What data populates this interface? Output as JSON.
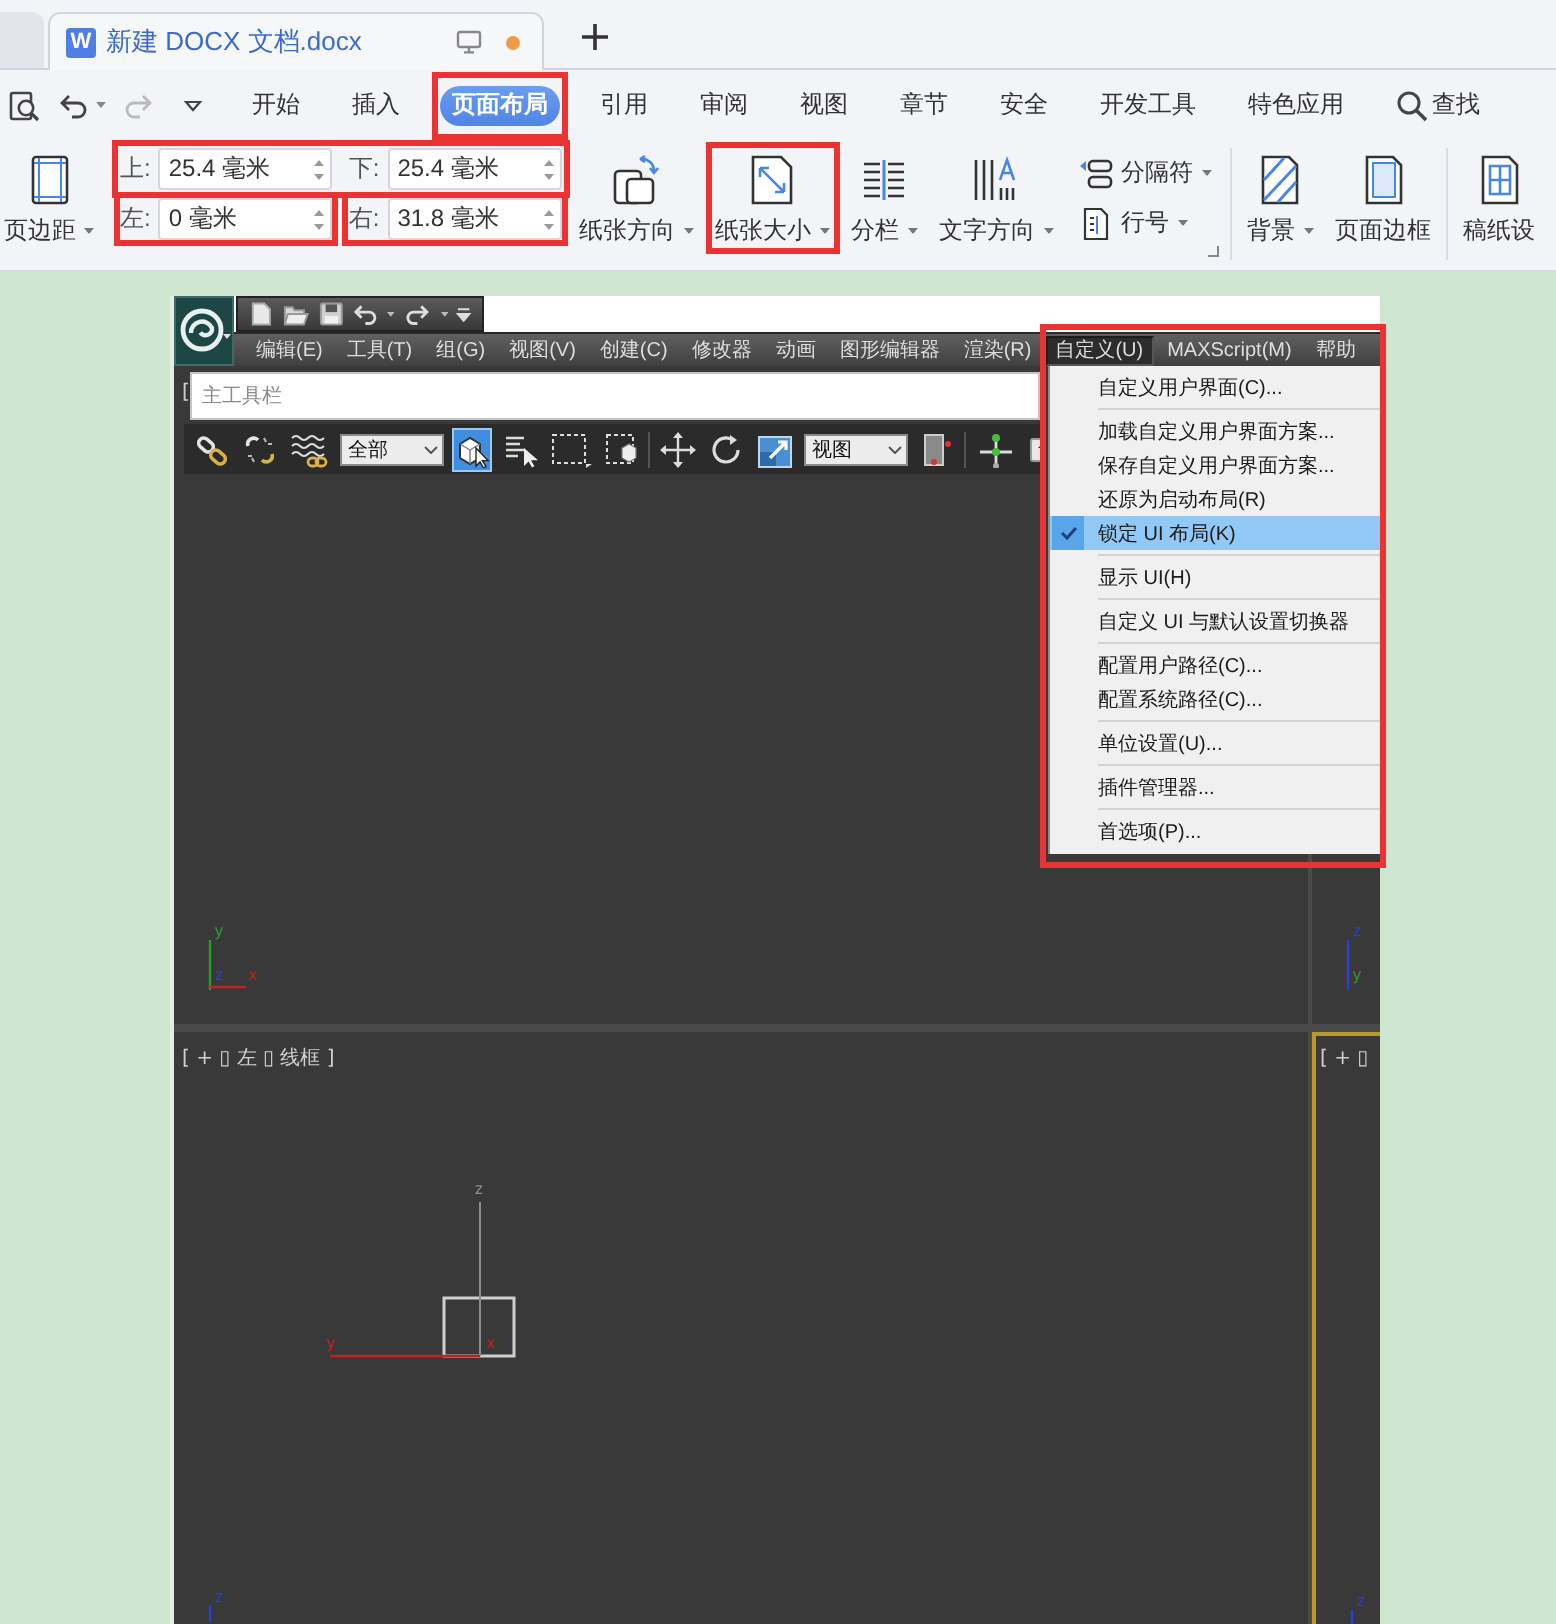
{
  "tab_bar": {
    "tabs": [
      {
        "icon_letter": "W",
        "title": "新建 DOCX 文档.docx",
        "selected": true,
        "unsaved": true
      }
    ]
  },
  "quick_access": [
    {
      "disabled": false
    },
    {
      "disabled": false
    },
    {
      "disabled": true
    }
  ],
  "menu_tabs": [
    {
      "label": "开始",
      "selected": false,
      "highlighted": false
    },
    {
      "label": "插入",
      "selected": false,
      "highlighted": false
    },
    {
      "label": "页面布局",
      "selected": true,
      "highlighted": true
    },
    {
      "label": "引用",
      "selected": false,
      "highlighted": false
    },
    {
      "label": "审阅",
      "selected": false,
      "highlighted": false
    },
    {
      "label": "视图",
      "selected": false,
      "highlighted": false
    },
    {
      "label": "章节",
      "selected": false,
      "highlighted": false
    },
    {
      "label": "安全",
      "selected": false,
      "highlighted": false
    },
    {
      "label": "开发工具",
      "selected": false,
      "highlighted": false
    },
    {
      "label": "特色应用",
      "selected": false,
      "highlighted": false
    }
  ],
  "search": {
    "label": "查找"
  },
  "ribbon": {
    "sections": [
      {
        "launcher": true,
        "items": [
          {
            "kind": "large",
            "label": "页边距",
            "dropdown": true,
            "highlighted": false
          },
          {
            "kind": "margins",
            "rows": [
              {
                "highlighted": true,
                "fields": [
                  {
                    "label": "上:",
                    "value": "25.4 毫米",
                    "highlighted": false
                  },
                  {
                    "label": "下:",
                    "value": "25.4 毫米",
                    "highlighted": false
                  }
                ]
              },
              {
                "highlighted": false,
                "fields": [
                  {
                    "label": "左:",
                    "value": "0 毫米",
                    "highlighted": true
                  },
                  {
                    "label": "右:",
                    "value": "31.8 毫米",
                    "highlighted": true
                  }
                ]
              }
            ]
          },
          {
            "kind": "large",
            "label": "纸张方向",
            "dropdown": true,
            "highlighted": false
          },
          {
            "kind": "large",
            "label": "纸张大小",
            "dropdown": true,
            "highlighted": true
          },
          {
            "kind": "large",
            "label": "分栏",
            "dropdown": true,
            "highlighted": false
          },
          {
            "kind": "large",
            "label": "文字方向",
            "dropdown": true,
            "highlighted": false
          },
          {
            "kind": "stack",
            "items": [
              {
                "label": "分隔符",
                "dropdown": true
              },
              {
                "label": "行号",
                "dropdown": true
              }
            ]
          }
        ]
      },
      {
        "items": [
          {
            "kind": "large",
            "label": "背景",
            "dropdown": true,
            "highlighted": false
          },
          {
            "kind": "large",
            "label": "页面边框",
            "dropdown": false,
            "highlighted": false
          }
        ]
      },
      {
        "items": [
          {
            "kind": "large",
            "label": "稿纸设",
            "dropdown": false,
            "highlighted": false
          }
        ]
      }
    ]
  },
  "max_window": {
    "menu_bar": [
      {
        "label": "编辑(E)",
        "selected": false
      },
      {
        "label": "工具(T)",
        "selected": false
      },
      {
        "label": "组(G)",
        "selected": false
      },
      {
        "label": "视图(V)",
        "selected": false
      },
      {
        "label": "创建(C)",
        "selected": false
      },
      {
        "label": "修改器",
        "selected": false
      },
      {
        "label": "动画",
        "selected": false
      },
      {
        "label": "图形编辑器",
        "selected": false
      },
      {
        "label": "渲染(R)",
        "selected": false
      },
      {
        "label": "自定义(U)",
        "selected": true
      },
      {
        "label": "MAXScript(M)",
        "selected": false
      },
      {
        "label": "帮助",
        "selected": false
      }
    ],
    "toolbar_title": "主工具栏",
    "toolbar": [
      {
        "kind": "tool",
        "selected": false
      },
      {
        "kind": "tool",
        "selected": false
      },
      {
        "kind": "tool",
        "selected": false
      },
      {
        "kind": "dropdown",
        "value": "全部"
      },
      {
        "kind": "tool",
        "selected": true
      },
      {
        "kind": "tool",
        "selected": false
      },
      {
        "kind": "tool",
        "selected": false
      },
      {
        "kind": "tool",
        "selected": false
      },
      {
        "kind": "separator"
      },
      {
        "kind": "tool",
        "selected": false
      },
      {
        "kind": "tool",
        "selected": false
      },
      {
        "kind": "tool",
        "selected": false
      },
      {
        "kind": "dropdown",
        "value": "视图"
      },
      {
        "kind": "tool",
        "selected": false
      },
      {
        "kind": "separator"
      },
      {
        "kind": "tool",
        "selected": false
      },
      {
        "kind": "tool",
        "selected": false
      }
    ],
    "viewports": [
      {
        "label": "[",
        "active": false,
        "gizmo": [
          {
            "text": "y",
            "color": "#2f9a2f"
          },
          {
            "text": "z",
            "color": "#2b3fd6"
          },
          {
            "text": "x",
            "color": "#c42222"
          }
        ]
      },
      {
        "active": false,
        "gizmo": [
          {
            "text": "z",
            "color": "#2b3fd6"
          },
          {
            "text": "y",
            "color": "#2f9a2f"
          }
        ]
      },
      {
        "label": "[ + ▯ 左 ▯ 线框 ]",
        "active": false,
        "object_axes": [
          {
            "text": "z",
            "color": "#8c8c8c"
          },
          {
            "text": "y",
            "color": "#c42222"
          },
          {
            "text": "x",
            "color": "#c42222"
          }
        ],
        "gizmo": [
          {
            "text": "z",
            "color": "#2b3fd6"
          }
        ]
      },
      {
        "label": "[ + ▯",
        "active": true,
        "gizmo": [
          {
            "text": "z",
            "color": "#2b3fd6"
          }
        ]
      }
    ],
    "menu": {
      "highlighted": true,
      "groups": [
        {
          "items": [
            {
              "label": "自定义用户界面(C)...",
              "checked": false,
              "selected": false
            }
          ]
        },
        {
          "items": [
            {
              "label": "加载自定义用户界面方案...",
              "checked": false,
              "selected": false
            },
            {
              "label": "保存自定义用户界面方案...",
              "checked": false,
              "selected": false
            },
            {
              "label": "还原为启动布局(R)",
              "checked": false,
              "selected": false
            },
            {
              "label": "锁定 UI 布局(K)",
              "checked": true,
              "selected": true
            }
          ]
        },
        {
          "items": [
            {
              "label": "显示 UI(H)",
              "checked": false,
              "selected": false
            }
          ]
        },
        {
          "items": [
            {
              "label": "自定义 UI 与默认设置切换器",
              "checked": false,
              "selected": false
            }
          ]
        },
        {
          "items": [
            {
              "label": "配置用户路径(C)...",
              "checked": false,
              "selected": false
            },
            {
              "label": "配置系统路径(C)...",
              "checked": false,
              "selected": false
            }
          ]
        },
        {
          "items": [
            {
              "label": "单位设置(U)...",
              "checked": false,
              "selected": false
            }
          ]
        },
        {
          "items": [
            {
              "label": "插件管理器...",
              "checked": false,
              "selected": false
            }
          ]
        },
        {
          "items": [
            {
              "label": "首选项(P)...",
              "checked": false,
              "selected": false
            }
          ]
        }
      ]
    }
  }
}
